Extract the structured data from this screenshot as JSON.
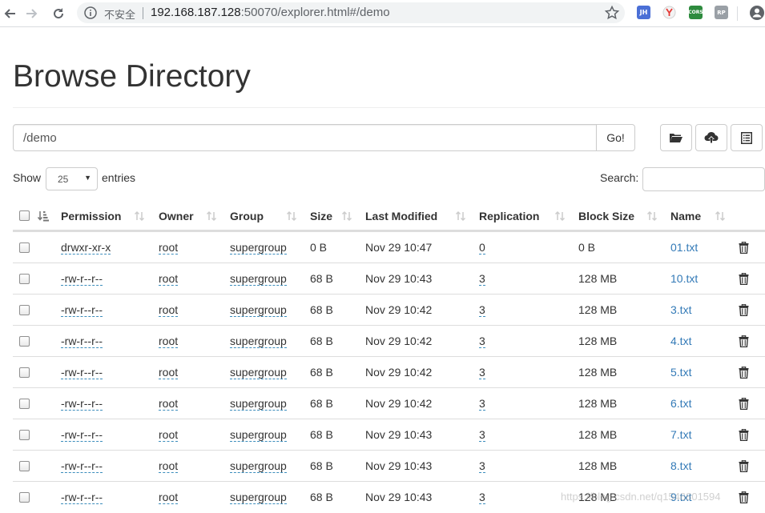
{
  "browser": {
    "security_label": "不安全",
    "url_host": "192.168.187.128",
    "url_rest": ":50070/explorer.html#/demo",
    "extensions": [
      "JH",
      "Y",
      "CORS",
      "RP"
    ]
  },
  "page": {
    "title": "Browse Directory",
    "path_value": "/demo",
    "go_label": "Go!",
    "show_label": "Show",
    "page_length": "25",
    "entries_label": "entries",
    "search_label": "Search:",
    "search_value": ""
  },
  "table": {
    "headers": {
      "permission": "Permission",
      "owner": "Owner",
      "group": "Group",
      "size": "Size",
      "last_modified": "Last Modified",
      "replication": "Replication",
      "block_size": "Block Size",
      "name": "Name"
    },
    "rows": [
      {
        "permission": "drwxr-xr-x",
        "owner": "root",
        "group": "supergroup",
        "size": "0 B",
        "modified": "Nov 29 10:47",
        "replication": "0",
        "block_size": "0 B",
        "name": "01.txt"
      },
      {
        "permission": "-rw-r--r--",
        "owner": "root",
        "group": "supergroup",
        "size": "68 B",
        "modified": "Nov 29 10:43",
        "replication": "3",
        "block_size": "128 MB",
        "name": "10.txt"
      },
      {
        "permission": "-rw-r--r--",
        "owner": "root",
        "group": "supergroup",
        "size": "68 B",
        "modified": "Nov 29 10:42",
        "replication": "3",
        "block_size": "128 MB",
        "name": "3.txt"
      },
      {
        "permission": "-rw-r--r--",
        "owner": "root",
        "group": "supergroup",
        "size": "68 B",
        "modified": "Nov 29 10:42",
        "replication": "3",
        "block_size": "128 MB",
        "name": "4.txt"
      },
      {
        "permission": "-rw-r--r--",
        "owner": "root",
        "group": "supergroup",
        "size": "68 B",
        "modified": "Nov 29 10:42",
        "replication": "3",
        "block_size": "128 MB",
        "name": "5.txt"
      },
      {
        "permission": "-rw-r--r--",
        "owner": "root",
        "group": "supergroup",
        "size": "68 B",
        "modified": "Nov 29 10:42",
        "replication": "3",
        "block_size": "128 MB",
        "name": "6.txt"
      },
      {
        "permission": "-rw-r--r--",
        "owner": "root",
        "group": "supergroup",
        "size": "68 B",
        "modified": "Nov 29 10:43",
        "replication": "3",
        "block_size": "128 MB",
        "name": "7.txt"
      },
      {
        "permission": "-rw-r--r--",
        "owner": "root",
        "group": "supergroup",
        "size": "68 B",
        "modified": "Nov 29 10:43",
        "replication": "3",
        "block_size": "128 MB",
        "name": "8.txt"
      },
      {
        "permission": "-rw-r--r--",
        "owner": "root",
        "group": "supergroup",
        "size": "68 B",
        "modified": "Nov 29 10:43",
        "replication": "3",
        "block_size": "128 MB",
        "name": "9.txt"
      }
    ]
  },
  "watermark": "https://blog.csdn.net/q1546801594",
  "icons": {
    "back": "arrow-left-icon",
    "forward": "arrow-right-icon",
    "reload": "reload-icon",
    "info": "info-icon",
    "star": "star-icon",
    "profile": "account-icon",
    "mkdir": "folder-open-icon",
    "upload": "cloud-upload-icon",
    "cut": "list-alt-icon",
    "delete": "trash-icon",
    "sort": "sort-icon"
  },
  "colors": {
    "link": "#337ab7",
    "dashed_underline": "#3c8dbc",
    "text": "#333333",
    "border": "#dddddd"
  }
}
